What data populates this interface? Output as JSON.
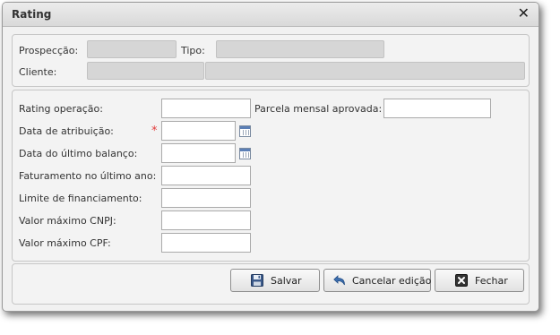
{
  "dialog": {
    "title": "Rating"
  },
  "header": {
    "prospeccao_label": "Prospecção:",
    "tipo_label": "Tipo:",
    "cliente_label": "Cliente:"
  },
  "form": {
    "rating_operacao": {
      "label": "Rating operação:",
      "value": ""
    },
    "parcela_mensal": {
      "label": "Parcela mensal aprovada:",
      "value": ""
    },
    "data_atribuicao": {
      "label": "Data de atribuição:",
      "value": "",
      "required_mark": "*"
    },
    "data_balanco": {
      "label": "Data do último balanço:",
      "value": ""
    },
    "faturamento": {
      "label": "Faturamento no último ano:",
      "value": ""
    },
    "limite": {
      "label": "Limite de financiamento:",
      "value": ""
    },
    "max_cnpj": {
      "label": "Valor máximo CNPJ:",
      "value": ""
    },
    "max_cpf": {
      "label": "Valor máximo CPF:",
      "value": ""
    }
  },
  "buttons": {
    "save": "Salvar",
    "cancel": "Cancelar edição",
    "close": "Fechar"
  },
  "icons": {
    "close": "close-icon",
    "calendar": "calendar-icon",
    "save": "floppy-disk-icon",
    "cancel": "undo-arrow-icon",
    "fechar": "x-box-icon"
  },
  "colors": {
    "required": "#e23b3b",
    "calendar_header": "#5b7fb6"
  }
}
